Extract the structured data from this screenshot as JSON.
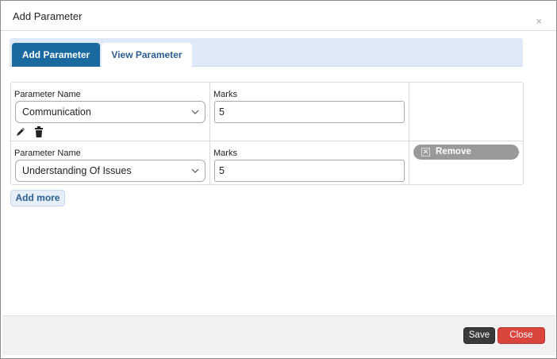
{
  "dialog": {
    "title": "Add Parameter",
    "close_symbol": "×"
  },
  "tabs": [
    {
      "label": "Add Parameter",
      "active": true
    },
    {
      "label": "View Parameter",
      "active": false
    }
  ],
  "rows": [
    {
      "parameter_label": "Parameter Name",
      "parameter_value": "Communication",
      "marks_label": "Marks",
      "marks_value": "5",
      "icons": [
        "pencil-icon",
        "trash-icon"
      ]
    },
    {
      "parameter_label": "Parameter Name",
      "parameter_value": "Understanding Of Issues",
      "marks_label": "Marks",
      "marks_value": "5",
      "remove_label": "Remove"
    }
  ],
  "add_more_label": "Add more",
  "footer": {
    "save_label": "Save",
    "close_label": "Close"
  },
  "colors": {
    "active_tab": "#1a6aa0",
    "tab_bar": "#dfe9f7",
    "close_button": "#d9443d",
    "save_button": "#3a3a3a",
    "remove_button": "#9a9a9a"
  }
}
